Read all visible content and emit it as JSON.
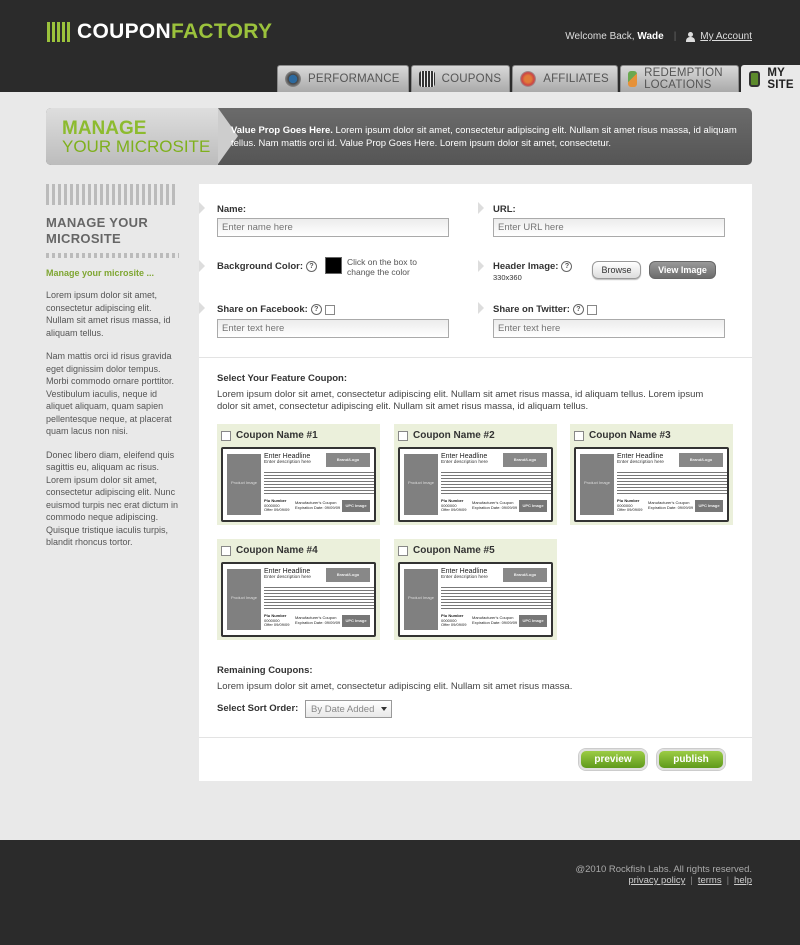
{
  "app": {
    "logo_left": "COUPON",
    "logo_right": "FACTORY",
    "welcome_prefix": "Welcome Back,",
    "user_name": "Wade",
    "my_account": "My Account",
    "accent_color": "#9bc23c"
  },
  "tabs": [
    {
      "label": "PERFORMANCE",
      "icon": "performance-gauge-icon"
    },
    {
      "label": "COUPONS",
      "icon": "barcode-icon"
    },
    {
      "label": "AFFILIATES",
      "icon": "affiliates-badge-icon"
    },
    {
      "label": "REDEMPTION LOCATIONS",
      "icon": "map-icon"
    },
    {
      "label": "MY SITE",
      "icon": "monitor-icon",
      "active": true
    }
  ],
  "banner": {
    "title_line1": "MANAGE",
    "title_line2": "YOUR MICROSITE",
    "value_prop_bold": "Value Prop Goes Here.",
    "value_prop_text": " Lorem ipsum dolor sit amet, consectetur adipiscing elit. Nullam sit amet risus massa, id aliquam tellus. Nam mattis orci id. Value Prop Goes Here. Lorem ipsum dolor sit amet, consectetur."
  },
  "sidebar": {
    "title_line1": "MANAGE YOUR",
    "title_line2": "MICROSITE",
    "subtitle": "Manage your microsite ...",
    "paragraphs": [
      "Lorem ipsum dolor sit amet, consectetur adipiscing elit. Nullam sit amet risus massa, id aliquam tellus.",
      "Nam mattis orci id risus gravida eget dignissim dolor tempus. Morbi commodo ornare porttitor. Vestibulum iaculis, neque id aliquet aliquam, quam sapien pellentesque neque, at placerat quam lacus non nisi.",
      "Donec libero diam, eleifend quis sagittis eu, aliquam ac risus. Lorem ipsum dolor sit amet, consectetur adipiscing elit. Nunc euismod turpis nec erat dictum in commodo neque adipiscing. Quisque tristique iaculis turpis, blandit rhoncus tortor."
    ]
  },
  "form": {
    "name_label": "Name:",
    "name_placeholder": "Enter name here",
    "url_label": "URL:",
    "url_placeholder": "Enter URL here",
    "bg_color_label": "Background Color:",
    "bg_color_note": "Click on the box to change the color",
    "bg_color_value": "#000000",
    "header_image_label": "Header Image:",
    "header_image_dims": "330x360",
    "browse_button": "Browse",
    "view_image_button": "View Image",
    "facebook_label": "Share on Facebook:",
    "facebook_placeholder": "Enter text here",
    "twitter_label": "Share on Twitter:",
    "twitter_placeholder": "Enter text here",
    "help_glyph": "?"
  },
  "feature": {
    "title": "Select Your Feature Coupon:",
    "text": "Lorem ipsum dolor sit amet, consectetur adipiscing elit. Nullam sit amet risus massa, id aliquam tellus. Lorem ipsum dolor sit amet, consectetur adipiscing elit. Nullam sit amet risus massa, id aliquam tellus.",
    "card": {
      "headline": "Enter Headline",
      "description": "Enter description here",
      "brand": "Brand/Logo",
      "product": "Product Image",
      "plu": "Plu Number",
      "plu_value": "0000000",
      "offer": "Offer 09/09/09",
      "manufacturer": "Manufacturer's Coupon",
      "expires": "Expiration Date: 09/09/09",
      "upc": "UPC Image"
    },
    "coupons": [
      {
        "name": "Coupon Name #1"
      },
      {
        "name": "Coupon Name #2"
      },
      {
        "name": "Coupon Name #3"
      },
      {
        "name": "Coupon Name #4"
      },
      {
        "name": "Coupon Name #5"
      }
    ]
  },
  "remaining": {
    "title": "Remaining Coupons:",
    "text": "Lorem ipsum dolor sit amet, consectetur adipiscing elit. Nullam sit amet risus massa.",
    "sort_label": "Select Sort Order:",
    "sort_value": "By Date Added"
  },
  "actions": {
    "preview": "preview",
    "publish": "publish"
  },
  "footer": {
    "copyright": "@2010 Rockfish Labs. All rights reserved.",
    "privacy": "privacy policy",
    "terms": "terms",
    "help": "help",
    "separator": "|"
  }
}
